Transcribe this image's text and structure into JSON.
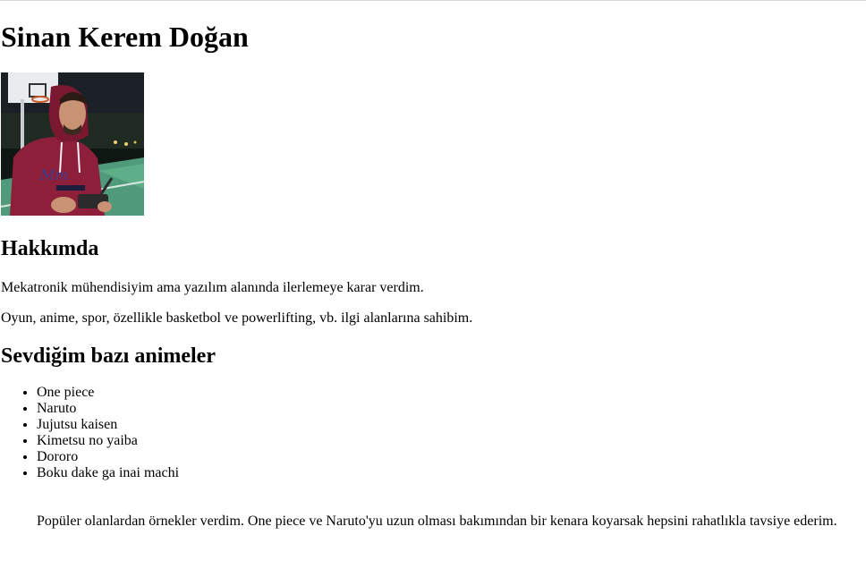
{
  "profile": {
    "name": "Sinan Kerem Doğan",
    "photo_icon": "profile-photo"
  },
  "about": {
    "heading": "Hakkımda",
    "paragraphs": [
      "Mekatronik mühendisiyim ama yazılım alanında ilerlemeye karar verdim.",
      "Oyun, anime, spor, özellikle basketbol ve powerlifting, vb. ilgi alanlarına sahibim."
    ]
  },
  "anime": {
    "heading": "Sevdiğim bazı animeler",
    "items": [
      "One piece",
      "Naruto",
      "Jujutsu kaisen",
      "Kimetsu no yaiba",
      "Dororo",
      "Boku dake ga inai machi"
    ],
    "note": "Popüler olanlardan örnekler verdim. One piece ve Naruto'yu uzun olması bakımından bir kenara koyarsak hepsini rahatlıkla tavsiye ederim."
  }
}
